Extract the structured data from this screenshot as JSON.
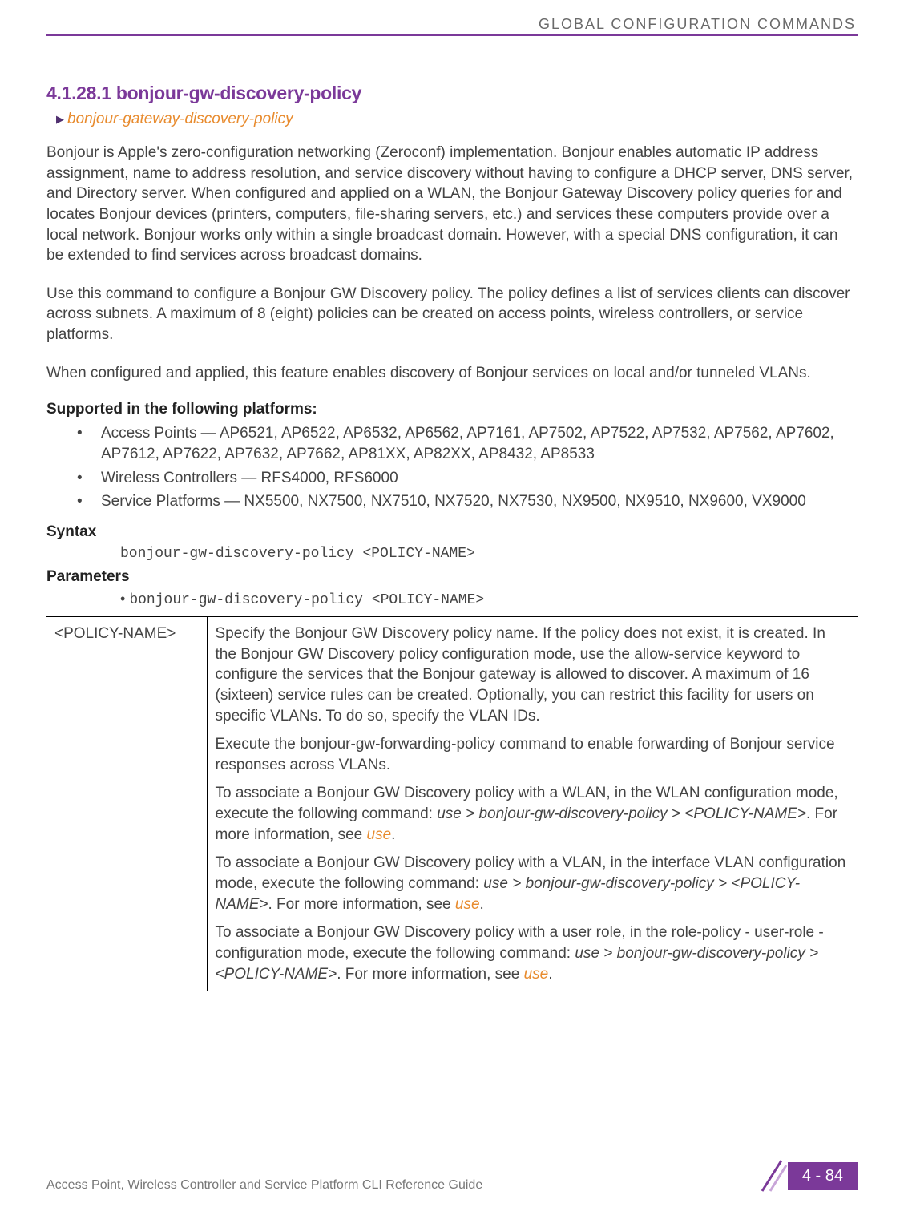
{
  "header": {
    "running_head": "GLOBAL CONFIGURATION COMMANDS"
  },
  "section": {
    "number_title": "4.1.28.1 bonjour-gw-discovery-policy",
    "breadcrumb": "bonjour-gateway-discovery-policy"
  },
  "paragraphs": {
    "p1": "Bonjour is Apple's zero-configuration networking (Zeroconf) implementation. Bonjour enables automatic IP address assignment, name to address resolution, and service discovery without having to configure a DHCP server, DNS server, and Directory server. When configured and applied on a WLAN, the Bonjour Gateway Discovery policy queries for and locates Bonjour devices (printers, computers, file-sharing servers, etc.) and services these computers provide over a local network. Bonjour works only within a single broadcast domain. However, with a special DNS configuration, it can be extended to find services across broadcast domains.",
    "p2": "Use this command to configure a Bonjour GW Discovery policy. The policy defines a list of services clients can discover across subnets. A maximum of 8 (eight) policies can be created on access points, wireless controllers, or service platforms.",
    "p3": "When configured and applied, this feature enables discovery of Bonjour services on local and/or tunneled VLANs."
  },
  "supported": {
    "heading": "Supported in the following platforms:",
    "items": [
      "Access Points — AP6521, AP6522, AP6532, AP6562, AP7161, AP7502, AP7522, AP7532, AP7562, AP7602, AP7612, AP7622, AP7632, AP7662, AP81XX, AP82XX, AP8432, AP8533",
      "Wireless Controllers — RFS4000, RFS6000",
      "Service Platforms — NX5500, NX7500, NX7510, NX7520, NX7530, NX9500, NX9510, NX9600, VX9000"
    ]
  },
  "syntax": {
    "heading": "Syntax",
    "line": "bonjour-gw-discovery-policy <POLICY-NAME>"
  },
  "parameters": {
    "heading": "Parameters",
    "bullet_line": "bonjour-gw-discovery-policy <POLICY-NAME>",
    "table": {
      "left": "<POLICY-NAME>",
      "cell1": "Specify the Bonjour GW Discovery policy name. If the policy does not exist, it is created. In the Bonjour GW Discovery policy configuration mode, use the allow-service keyword to configure the services that the Bonjour gateway is allowed to discover. A maximum of 16 (sixteen) service rules can be created. Optionally, you can restrict this facility for users on specific VLANs. To do so, specify the VLAN IDs.",
      "cell2": "Execute the bonjour-gw-forwarding-policy command to enable forwarding of Bonjour service responses across VLANs.",
      "cell3a": "To associate a Bonjour GW Discovery policy with a WLAN, in the WLAN configuration mode, execute the following command: ",
      "cell3_cmd": "use > bonjour-gw-discovery-policy > <POLICY-NAME>",
      "cell3b": ". For more information, see ",
      "cell3_link": "use",
      "cell4a": "To associate a Bonjour GW Discovery policy with a VLAN, in the interface VLAN configuration mode, execute the following command: ",
      "cell4_cmd": "use > bonjour-gw-discovery-policy > <POLICY-NAME>",
      "cell4b": ". For more information, see ",
      "cell4_link": "use",
      "cell5a": "To associate a Bonjour GW Discovery policy with a user role, in the role-policy - user-role - configuration mode, execute the following command: ",
      "cell5_cmd": "use > bonjour-gw-discovery-policy > <POLICY-NAME>",
      "cell5b": ". For more information, see ",
      "cell5_link": "use"
    }
  },
  "footer": {
    "guide": "Access Point, Wireless Controller and Service Platform CLI Reference Guide",
    "page": "4 - 84"
  }
}
